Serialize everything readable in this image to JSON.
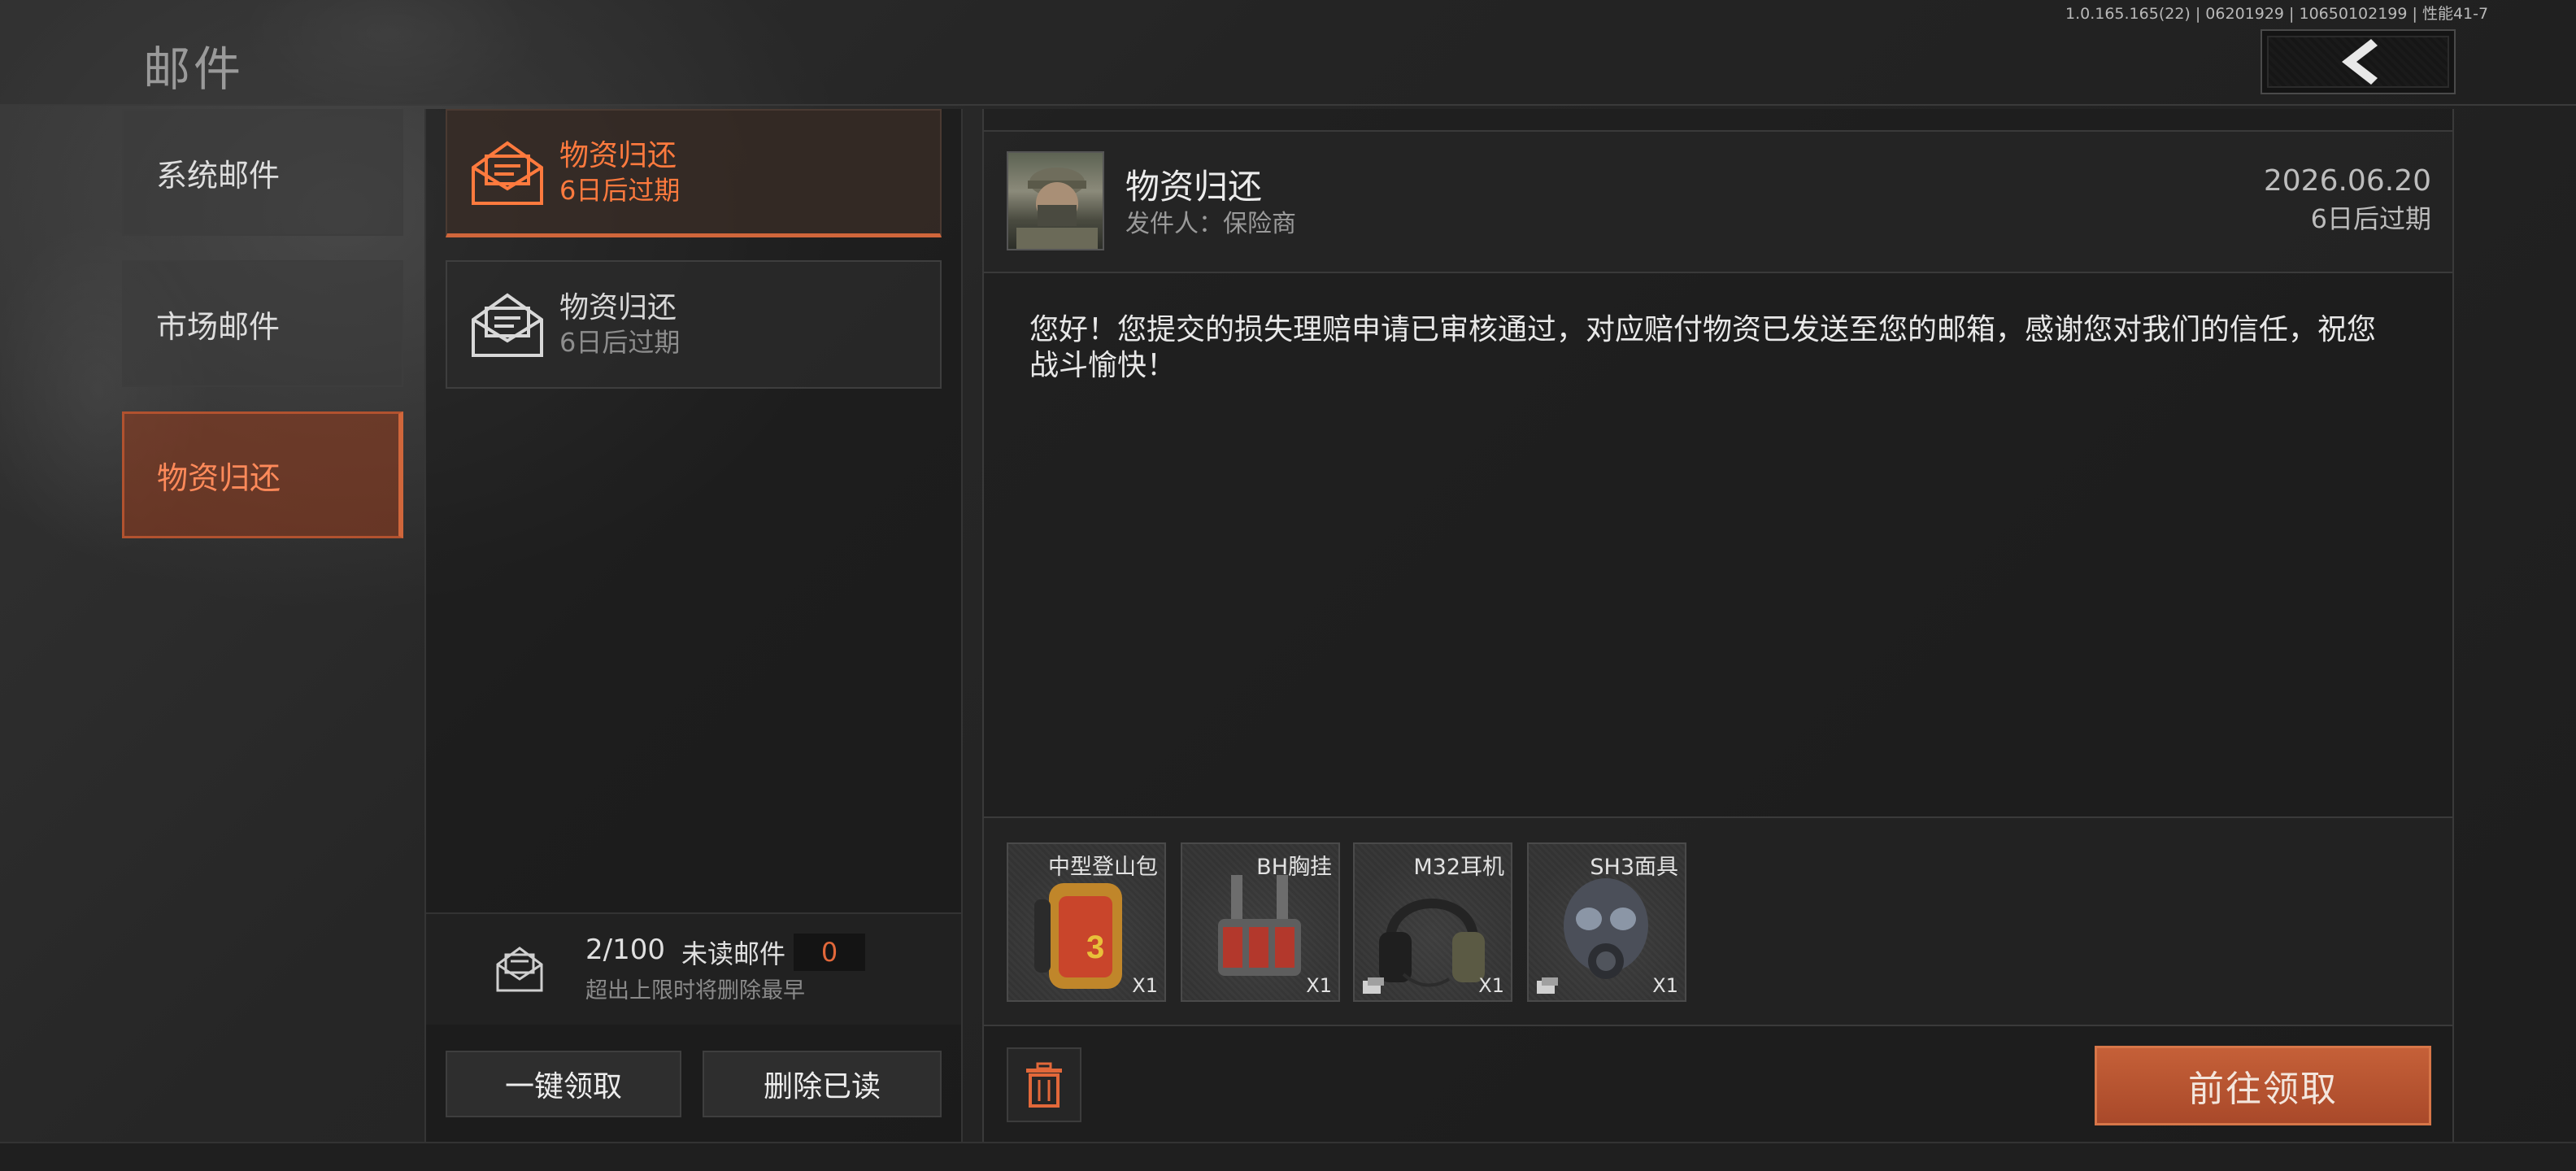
{
  "header": {
    "title": "邮件",
    "version": "1.0.165.165(22) | 06201929 | 10650102199 | 性能41-7",
    "back_icon": "chevron-left-icon"
  },
  "categories": [
    {
      "label": "系统邮件",
      "active": false
    },
    {
      "label": "市场邮件",
      "active": false
    },
    {
      "label": "物资归还",
      "active": true
    }
  ],
  "mail_list": [
    {
      "title": "物资归还",
      "expire": "6日后过期",
      "active": true,
      "icon": "envelope-open-icon"
    },
    {
      "title": "物资归还",
      "expire": "6日后过期",
      "active": false,
      "icon": "envelope-open-icon"
    }
  ],
  "mailbox_stats": {
    "count": "2/100",
    "unread_label": "未读邮件",
    "unread_value": "0",
    "limit_tip": "超出上限时将删除最早"
  },
  "list_actions": {
    "claim_all": "一键领取",
    "delete_read": "删除已读"
  },
  "detail": {
    "title": "物资归还",
    "sender": "发件人：保险商",
    "date": "2026.06.20",
    "expire": "6日后过期",
    "body": "您好！您提交的损失理赔申请已审核通过，对应赔付物资已发送至您的邮箱，感谢您对我们的信任，祝您战斗愉快！",
    "attachments": [
      {
        "name": "中型登山包",
        "qty": "X1"
      },
      {
        "name": "BH胸挂",
        "qty": "X1"
      },
      {
        "name": "M32耳机",
        "qty": "X1"
      },
      {
        "name": "SH3面具",
        "qty": "X1"
      }
    ],
    "claim_label": "前往领取"
  },
  "colors": {
    "accent": "#d0663b",
    "accent_text": "#ff7a3e",
    "claim_button": "#b85330"
  }
}
